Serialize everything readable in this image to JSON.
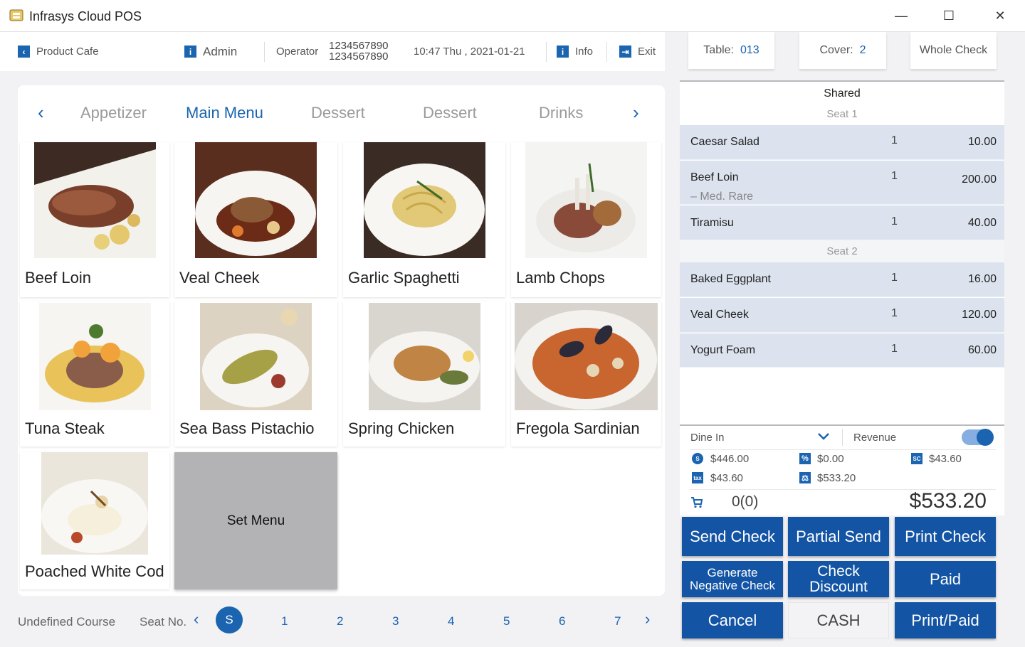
{
  "window": {
    "title": "Infrasys Cloud POS",
    "minimize": "—",
    "maximize": "☐",
    "close": "✕"
  },
  "infobar": {
    "outlet": "Product Cafe",
    "user": "Admin",
    "operator_label": "Operator",
    "operator_line1": "1234567890",
    "operator_line2": "1234567890",
    "datetime": "10:47 Thu , 2021-01-21",
    "info_label": "Info",
    "exit_label": "Exit"
  },
  "tabs": {
    "items": [
      "Appetizer",
      "Main Menu",
      "Dessert",
      "Dessert",
      "Drinks"
    ],
    "active": "Main Menu",
    "prev": "‹",
    "next": "›"
  },
  "menu_items": [
    "Beef Loin",
    "Veal Cheek",
    "Garlic Spaghetti",
    "Lamb Chops",
    "Tuna Steak",
    "Sea Bass Pistachio",
    "Spring Chicken",
    "Fregola Sardinian",
    "Poached White Cod"
  ],
  "set_menu_label": "Set Menu",
  "seatbar": {
    "course": "Undefined Course",
    "seat_label": "Seat No.",
    "prev": "‹",
    "next": "›",
    "current": "S",
    "seats": [
      "1",
      "2",
      "3",
      "4",
      "5",
      "6",
      "7"
    ]
  },
  "check_header": {
    "table_label": "Table:",
    "table_value": "013",
    "cover_label": "Cover:",
    "cover_value": "2",
    "whole_check": "Whole Check"
  },
  "order": {
    "shared_label": "Shared",
    "seat1_label": "Seat 1",
    "seat2_label": "Seat 2",
    "seat1_items": [
      {
        "name": "Caesar Salad",
        "qty": "1",
        "price": "10.00"
      },
      {
        "name": "Beef Loin",
        "qty": "1",
        "price": "200.00",
        "modifier": "– Med. Rare"
      },
      {
        "name": "Tiramisu",
        "qty": "1",
        "price": "40.00"
      }
    ],
    "seat2_items": [
      {
        "name": "Baked Eggplant",
        "qty": "1",
        "price": "16.00"
      },
      {
        "name": "Veal Cheek",
        "qty": "1",
        "price": "120.00"
      },
      {
        "name": "Yogurt Foam",
        "qty": "1",
        "price": "60.00"
      }
    ]
  },
  "summary": {
    "order_type": "Dine In",
    "revenue_label": "Revenue",
    "revenue_enabled": true,
    "subtotal": "$446.00",
    "discount": "$0.00",
    "service_charge": "$43.60",
    "tax": "$43.60",
    "net_total": "$533.20",
    "item_count": "0(0)",
    "grand_total": "$533.20",
    "icons": {
      "subtotal": "S",
      "discount": "%",
      "service_charge": "SC",
      "tax": "tax",
      "net": "⚖"
    }
  },
  "actions": {
    "send_check": "Send Check",
    "partial_send": "Partial Send",
    "print_check": "Print Check",
    "generate_negative_1": "Generate",
    "generate_negative_2": "Negative Check",
    "check_discount_1": "Check",
    "check_discount_2": "Discount",
    "paid": "Paid",
    "cancel": "Cancel",
    "cash": "CASH",
    "print_paid": "Print/Paid"
  },
  "colors": {
    "accent": "#1a64b0",
    "button": "#1354a4",
    "order_row": "#dce3ee",
    "set_menu": "#b3b2b4"
  }
}
